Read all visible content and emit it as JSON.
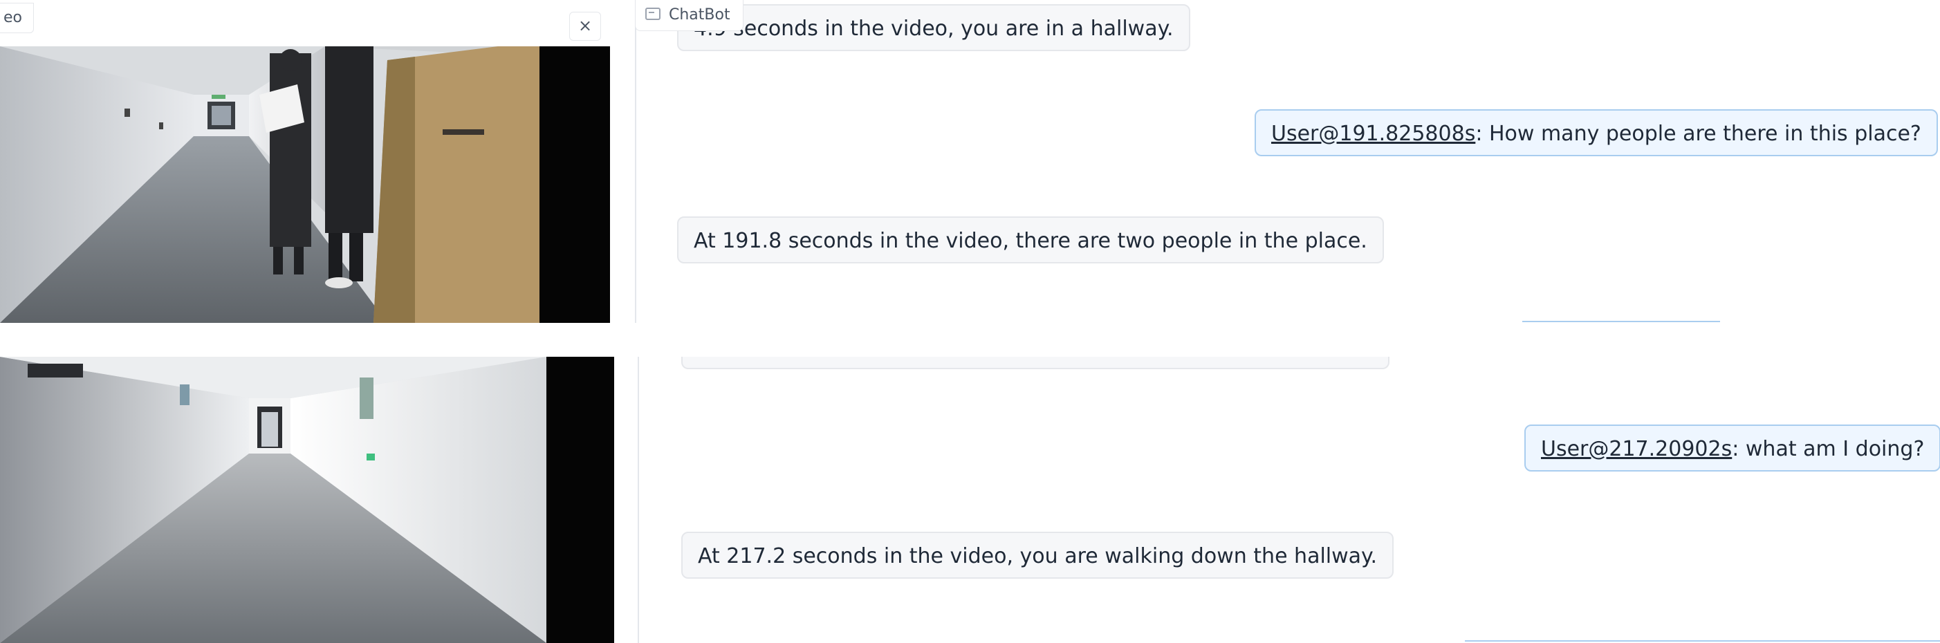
{
  "video_tab_label": "eo",
  "close_glyph": "×",
  "chatbot_tab_label": "ChatBot",
  "top": {
    "messages": [
      {
        "role": "bot",
        "text": "4.9 seconds in the video, you are in a hallway."
      },
      {
        "role": "user",
        "who": "User@191.825808s",
        "text": ": How many people are there in this place?"
      },
      {
        "role": "bot",
        "text": "At 191.8 seconds in the video, there are two people in the place."
      }
    ]
  },
  "bottom": {
    "messages": [
      {
        "role": "user",
        "who": "User@217.20902s",
        "text": ": what am I doing?"
      },
      {
        "role": "bot",
        "text": "At 217.2 seconds in the video, you are walking down the hallway."
      }
    ]
  },
  "colors": {
    "bot_bubble": "#f6f7f9",
    "user_bubble": "#eef6ff",
    "user_border": "#a9cdef"
  }
}
